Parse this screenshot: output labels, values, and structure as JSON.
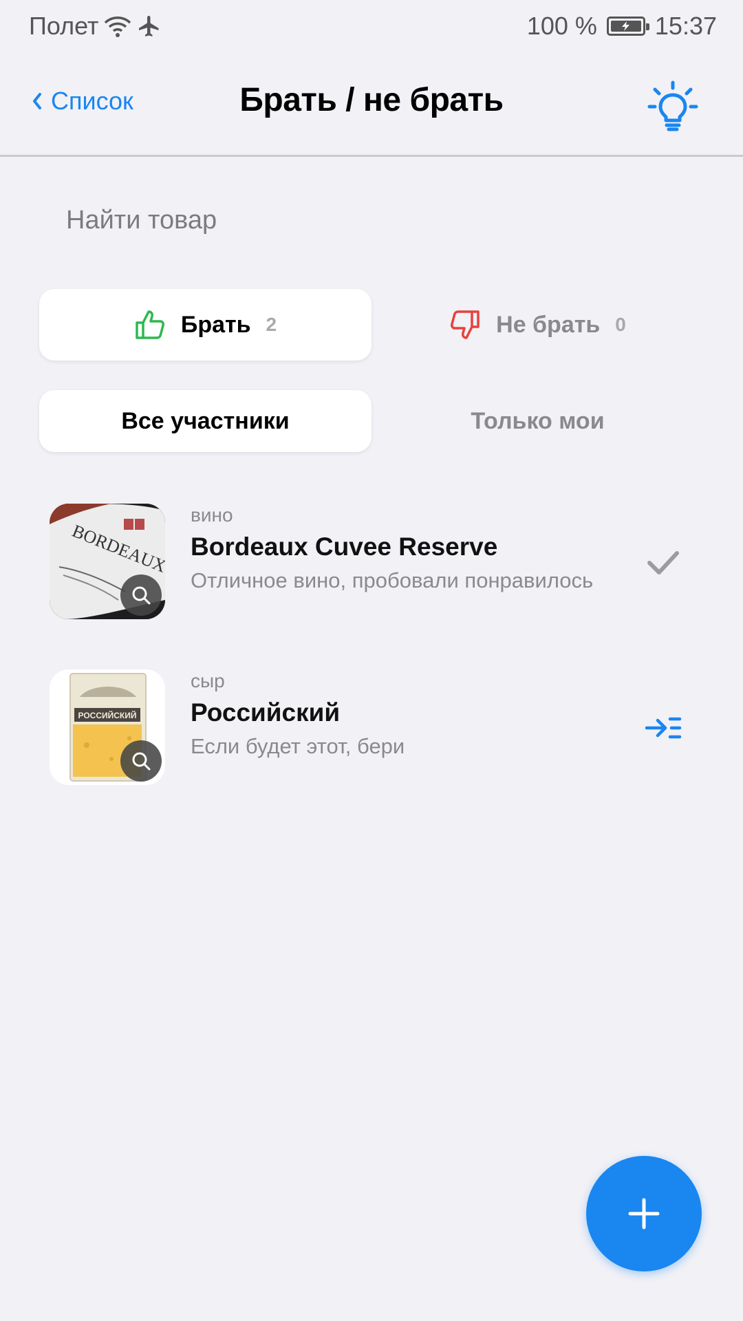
{
  "status_bar": {
    "carrier": "Полет",
    "battery": "100 %",
    "time": "15:37",
    "icons": [
      "wifi-icon",
      "airplane-icon",
      "battery-icon"
    ]
  },
  "nav": {
    "back_label": "Список",
    "title": "Брать / не брать",
    "tip_icon": "lightbulb-icon"
  },
  "search": {
    "placeholder": "Найти товар",
    "value": ""
  },
  "vote_tabs": {
    "take": {
      "label": "Брать",
      "count": "2",
      "icon": "thumbs-up-icon"
    },
    "skip": {
      "label": "Не брать",
      "count": "0",
      "icon": "thumbs-down-icon"
    },
    "selected": "take"
  },
  "owner_tabs": {
    "all": "Все участники",
    "mine": "Только мои",
    "selected": "all"
  },
  "items": [
    {
      "category": "вино",
      "name": "Bordeaux Cuvee Reserve",
      "comment": "Отличное вино, пробовали понравилось",
      "image": "wine-bottle-label",
      "label_text": "BORDEAUX",
      "action_icon": "checkmark-icon"
    },
    {
      "category": "сыр",
      "name": "Российский",
      "comment": "Если будет этот, бери",
      "image": "cheese-package",
      "label_text": "РОССИЙСКИЙ",
      "action_icon": "move-to-list-icon"
    }
  ],
  "fab": {
    "icon": "plus-icon"
  },
  "colors": {
    "accent": "#1a86f0",
    "background": "#f1f1f6",
    "like_green": "#2db94d",
    "dislike_red": "#e8413b",
    "secondary_text": "#8a8a8e"
  }
}
